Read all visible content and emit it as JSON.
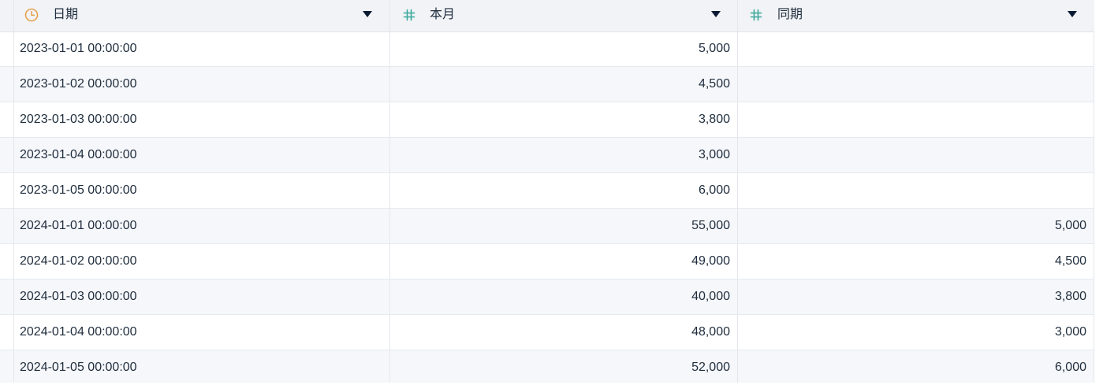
{
  "columns": [
    {
      "label": "日期",
      "type_icon": "clock-icon",
      "icon_color": "#e8a14f"
    },
    {
      "label": "本月",
      "type_icon": "hash-icon",
      "icon_color": "#3aa89b"
    },
    {
      "label": "同期",
      "type_icon": "hash-icon",
      "icon_color": "#3aa89b"
    }
  ],
  "rows": [
    {
      "date": "2023-01-01 00:00:00",
      "current": "5,000",
      "prior": ""
    },
    {
      "date": "2023-01-02 00:00:00",
      "current": "4,500",
      "prior": ""
    },
    {
      "date": "2023-01-03 00:00:00",
      "current": "3,800",
      "prior": ""
    },
    {
      "date": "2023-01-04 00:00:00",
      "current": "3,000",
      "prior": ""
    },
    {
      "date": "2023-01-05 00:00:00",
      "current": "6,000",
      "prior": ""
    },
    {
      "date": "2024-01-01 00:00:00",
      "current": "55,000",
      "prior": "5,000"
    },
    {
      "date": "2024-01-02 00:00:00",
      "current": "49,000",
      "prior": "4,500"
    },
    {
      "date": "2024-01-03 00:00:00",
      "current": "40,000",
      "prior": "3,800"
    },
    {
      "date": "2024-01-04 00:00:00",
      "current": "48,000",
      "prior": "3,000"
    },
    {
      "date": "2024-01-05 00:00:00",
      "current": "52,000",
      "prior": "6,000"
    }
  ]
}
